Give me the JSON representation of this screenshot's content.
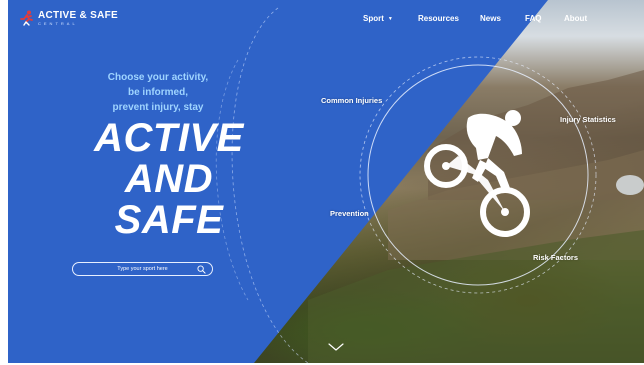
{
  "brand": {
    "name": "ACTIVE & SAFE",
    "sub": "CENTRAL",
    "colors": {
      "primary": "#2f63c8",
      "accent_red": "#e23b3b",
      "tagline": "#9fd4ff"
    }
  },
  "nav": {
    "items": [
      {
        "label": "Sport",
        "icon": "caret-down-icon"
      },
      {
        "label": "Resources"
      },
      {
        "label": "News"
      },
      {
        "label": "FAQ"
      },
      {
        "label": "About"
      }
    ]
  },
  "hero": {
    "tagline_lines": [
      "Choose your activity,",
      "be informed,",
      "prevent injury, stay"
    ],
    "headline_lines": [
      "ACTIVE",
      "AND",
      "SAFE"
    ]
  },
  "search": {
    "placeholder": "Type your sport here",
    "icon": "search-icon"
  },
  "circle_labels": {
    "common_injuries": "Common Injuries",
    "injury_statistics": "Injury Statistics",
    "prevention": "Prevention",
    "risk_factors": "Risk Factors"
  },
  "scroll": {
    "icon": "chevron-down-icon"
  }
}
